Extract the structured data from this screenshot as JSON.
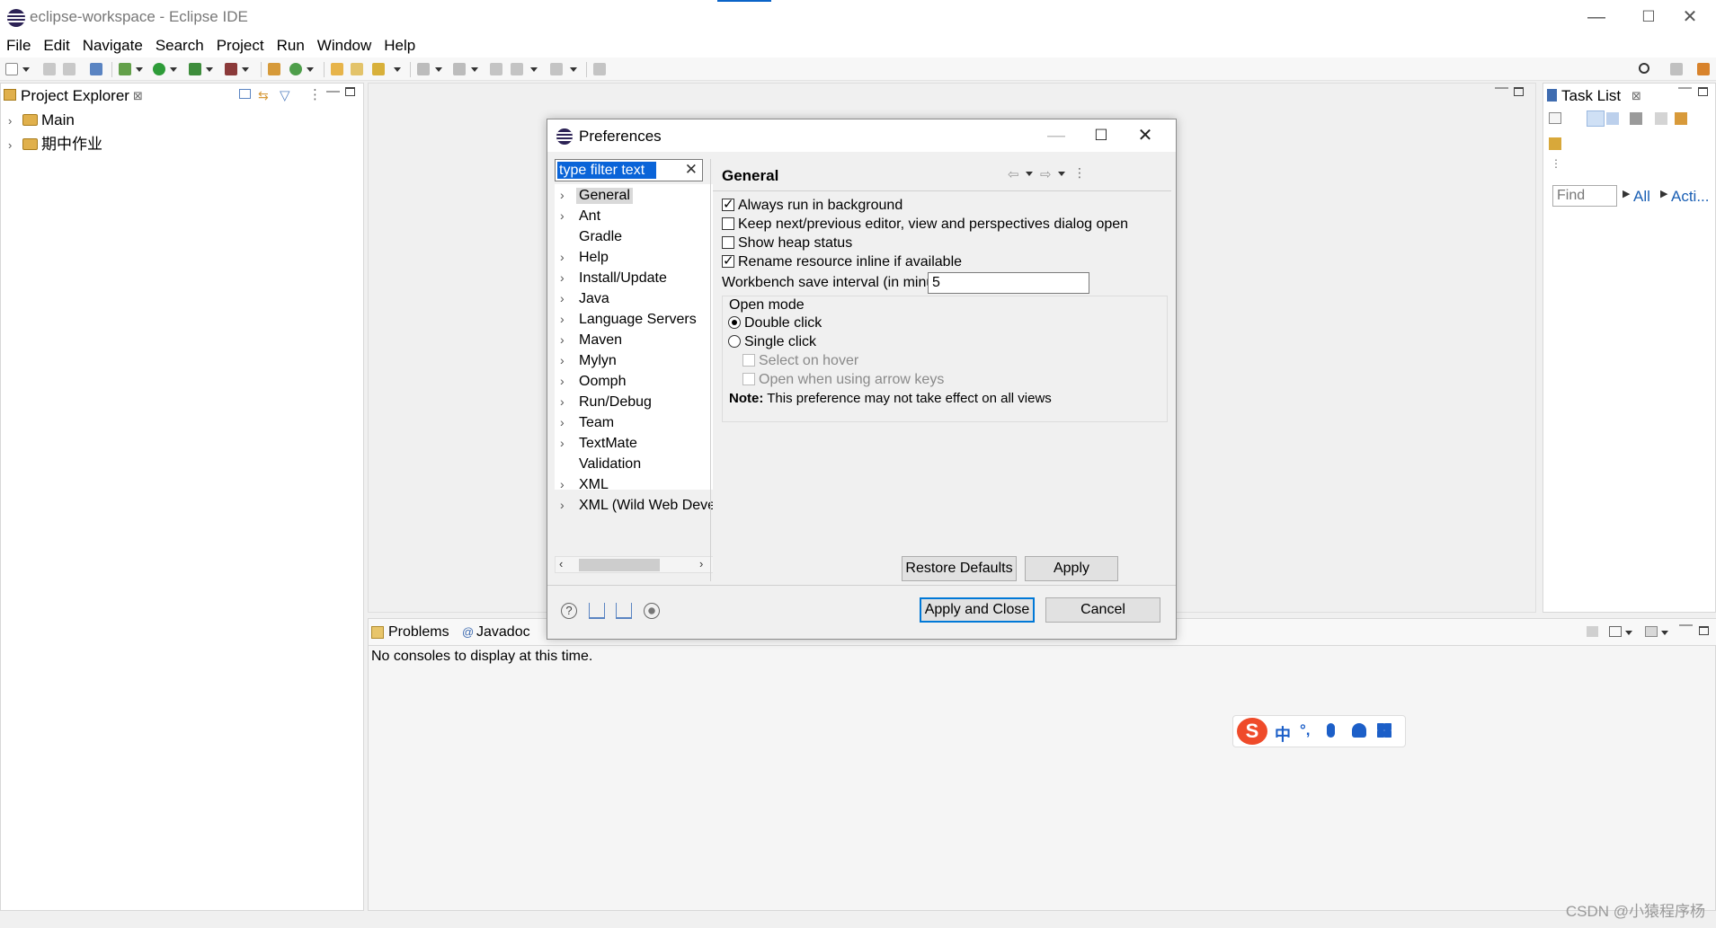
{
  "window": {
    "title": "eclipse-workspace - Eclipse IDE",
    "controls": [
      "—",
      "☐",
      "✕"
    ]
  },
  "menu": [
    "File",
    "Edit",
    "Navigate",
    "Search",
    "Project",
    "Run",
    "Window",
    "Help"
  ],
  "project_explorer": {
    "tab_label": "Project Explorer",
    "projects": [
      "Main",
      "期中作业"
    ]
  },
  "task_list": {
    "tab_label": "Task List",
    "find_placeholder": "Find",
    "all_link": "All",
    "activate_link": "Acti..."
  },
  "console": {
    "tabs": [
      "Problems",
      "Javadoc"
    ],
    "message": "No consoles to display at this time."
  },
  "ime": {
    "mode_label": "中",
    "punct_label": "°,"
  },
  "watermark": "CSDN @小猿程序杨",
  "dialog": {
    "title": "Preferences",
    "filter_value": "type filter text",
    "tree": [
      {
        "label": "General",
        "expandable": true,
        "selected": true
      },
      {
        "label": "Ant",
        "expandable": true
      },
      {
        "label": "Gradle",
        "expandable": false
      },
      {
        "label": "Help",
        "expandable": true
      },
      {
        "label": "Install/Update",
        "expandable": true
      },
      {
        "label": "Java",
        "expandable": true
      },
      {
        "label": "Language Servers",
        "expandable": true
      },
      {
        "label": "Maven",
        "expandable": true
      },
      {
        "label": "Mylyn",
        "expandable": true
      },
      {
        "label": "Oomph",
        "expandable": true
      },
      {
        "label": "Run/Debug",
        "expandable": true
      },
      {
        "label": "Team",
        "expandable": true
      },
      {
        "label": "TextMate",
        "expandable": true
      },
      {
        "label": "Validation",
        "expandable": false
      },
      {
        "label": "XML",
        "expandable": true
      },
      {
        "label": "XML (Wild Web Developer)",
        "expandable": true
      }
    ],
    "page": {
      "title": "General",
      "checkboxes": [
        {
          "label": "Always run in background",
          "checked": true
        },
        {
          "label": "Keep next/previous editor, view and perspectives dialog open",
          "checked": false
        },
        {
          "label": "Show heap status",
          "checked": false
        },
        {
          "label": "Rename resource inline if available",
          "checked": true
        }
      ],
      "interval_label": "Workbench save interval (in minutes):",
      "interval_value": "5",
      "open_mode": {
        "label": "Open mode",
        "double_click": "Double click",
        "single_click": "Single click",
        "selected": "Double click",
        "select_on_hover": "Select on hover",
        "open_arrow_keys": "Open when using arrow keys",
        "note_bold": "Note:",
        "note_text": "This preference may not take effect on all views"
      },
      "restore_defaults": "Restore Defaults",
      "apply": "Apply"
    },
    "apply_close": "Apply and Close",
    "cancel": "Cancel"
  }
}
